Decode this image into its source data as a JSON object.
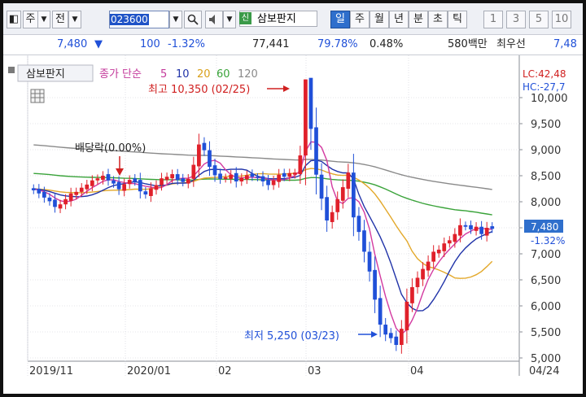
{
  "toolbar": {
    "mode_label": "주",
    "jeon_label": "전",
    "code_value": "023600",
    "shin_label": "신",
    "stock_name": "삼보판지",
    "periods": [
      {
        "label": "일",
        "active": true
      },
      {
        "label": "주"
      },
      {
        "label": "월"
      },
      {
        "label": "년"
      },
      {
        "label": "분"
      },
      {
        "label": "초"
      },
      {
        "label": "틱"
      }
    ],
    "numbers": [
      "1",
      "3",
      "5",
      "10"
    ]
  },
  "quote": {
    "price": "7,480",
    "direction": "▼",
    "change": "100",
    "change_pct": "-1.32%",
    "volume": "77,441",
    "vol_ratio": "79.78%",
    "turnover": "0.48%",
    "amount": "580백만",
    "min_label": "최우선",
    "last": "7,48"
  },
  "chart": {
    "legend_name": "삼보판지",
    "ma_label": "종가 단순",
    "ma_periods": [
      "5",
      "10",
      "20",
      "60",
      "120"
    ],
    "lc_label": "LC:42,48",
    "hc_label": "HC:-27,7",
    "high_annotation": "최고 10,350 (02/25)",
    "low_annotation": "최저 5,250 (03/23)",
    "dividend_annotation": "배당락(0.00%)",
    "current_price_tag": "7,480",
    "current_pct_tag": "-1.32%"
  },
  "chart_data": {
    "type": "candlestick",
    "y_axis": [
      "10,000",
      "9,500",
      "9,000",
      "8,500",
      "8,000",
      "7,500",
      "7,000",
      "6,500",
      "6,000",
      "5,500",
      "5,000"
    ],
    "x_axis": [
      "2019/11",
      "2020/01",
      "02",
      "03",
      "04",
      "04/24"
    ],
    "ylim": [
      5000,
      10350
    ],
    "ma_colors": {
      "5": "#d33aa0",
      "10": "#2033a8",
      "20": "#e3a82a",
      "60": "#3aa33a",
      "120": "#8a8a8a"
    },
    "up_color": "#e0202a",
    "down_color": "#2050d8",
    "high": {
      "value": 10350,
      "date": "02/25"
    },
    "low": {
      "value": 5250,
      "date": "03/23"
    },
    "current": 7480
  }
}
